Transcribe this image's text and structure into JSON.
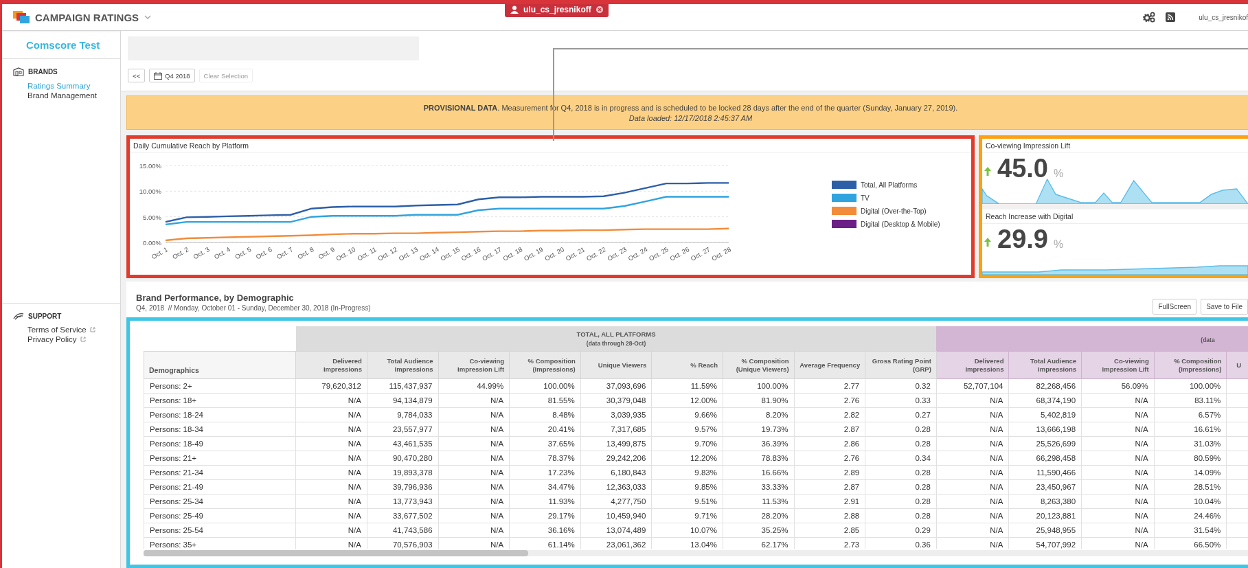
{
  "page_frame": {
    "color": "#d9343a"
  },
  "header": {
    "app_title": "CAMPAIGN RATINGS",
    "user_chip": "ulu_cs_jresnikoff",
    "user_name": "ulu_cs_jresnikof"
  },
  "sidebar": {
    "org": "Comscore Test",
    "sections": [
      {
        "title": "BRANDS",
        "kind": "brands",
        "items": [
          {
            "label": "Ratings Summary",
            "selected": true,
            "external": false
          },
          {
            "label": "Brand Management",
            "selected": false,
            "external": false
          }
        ]
      },
      {
        "title": "SUPPORT",
        "kind": "support",
        "items": [
          {
            "label": "Terms of Service",
            "selected": false,
            "external": true
          },
          {
            "label": "Privacy Policy",
            "selected": false,
            "external": true
          }
        ]
      }
    ]
  },
  "toolbar": {
    "back": "<<",
    "period": "Q4 2018",
    "clear": {
      "label": "Clear Selection",
      "disabled": true
    }
  },
  "banner": {
    "message": "**PROVISIONAL DATA**. Measurement for Q4, 2018 is in progress and is scheduled to be locked 28 days after the end of the quarter (Sunday, January 27, 2019).",
    "loaded": "Data loaded: 12/17/2018 2:45:37 AM"
  },
  "reach_chart": {
    "color": "#e23b2e",
    "chart_data": {
      "type": "line",
      "title": "Daily Cumulative Reach by Platform",
      "legend": true,
      "categories": [
        "Oct. 1",
        "Oct. 2",
        "Oct. 3",
        "Oct. 4",
        "Oct. 5",
        "Oct. 6",
        "Oct. 7",
        "Oct. 8",
        "Oct. 9",
        "Oct. 10",
        "Oct. 11",
        "Oct. 12",
        "Oct. 13",
        "Oct. 14",
        "Oct. 15",
        "Oct. 16",
        "Oct. 17",
        "Oct. 18",
        "Oct. 19",
        "Oct. 20",
        "Oct. 21",
        "Oct. 22",
        "Oct. 23",
        "Oct. 24",
        "Oct. 25",
        "Oct. 26",
        "Oct. 27",
        "Oct. 28"
      ],
      "ylim": [
        0,
        15
      ],
      "yticks": [
        {
          "value": 0,
          "label": "0.00%"
        },
        {
          "value": 5,
          "label": "5.00%"
        },
        {
          "value": 10,
          "label": "10.00%"
        },
        {
          "value": 15,
          "label": "15.00%"
        }
      ],
      "series": [
        {
          "name": "Total, All Platforms",
          "color": "#2c5fa8",
          "values": [
            4.0,
            4.9,
            5.0,
            5.1,
            5.2,
            5.3,
            5.4,
            6.6,
            6.9,
            7.0,
            7.0,
            7.0,
            7.2,
            7.3,
            7.4,
            8.4,
            8.8,
            8.8,
            8.9,
            8.9,
            8.9,
            9.0,
            9.7,
            10.6,
            11.5,
            11.5,
            11.6,
            11.6
          ]
        },
        {
          "name": "TV",
          "color": "#2fa4df",
          "values": [
            3.5,
            4.0,
            4.0,
            4.0,
            4.0,
            4.0,
            4.0,
            5.0,
            5.2,
            5.2,
            5.2,
            5.2,
            5.4,
            5.4,
            5.4,
            6.3,
            6.6,
            6.6,
            6.6,
            6.6,
            6.6,
            6.6,
            7.1,
            8.0,
            8.9,
            8.9,
            8.9,
            8.9
          ]
        },
        {
          "name": "Digital (Over-the-Top)",
          "color": "#f28c3a",
          "values": [
            0.4,
            0.8,
            0.9,
            1.0,
            1.1,
            1.2,
            1.3,
            1.4,
            1.6,
            1.7,
            1.7,
            1.8,
            1.8,
            1.9,
            2.0,
            2.1,
            2.2,
            2.2,
            2.3,
            2.3,
            2.4,
            2.4,
            2.5,
            2.6,
            2.6,
            2.6,
            2.6,
            2.7
          ]
        },
        {
          "name": "Digital (Desktop & Mobile)",
          "color": "#6b1f86",
          "values": [
            null,
            null,
            null,
            null,
            null,
            null,
            null,
            null,
            null,
            null,
            null,
            null,
            null,
            null,
            null,
            null,
            null,
            null,
            null,
            null,
            null,
            null,
            null,
            null,
            null,
            null,
            null,
            null
          ]
        }
      ]
    }
  },
  "kpis": {
    "color": "#ffa00f",
    "cards": [
      {
        "title": "Co-viewing Impression Lift",
        "value": "45.0",
        "unit": "%",
        "increase": true
      },
      {
        "title": "Reach Increase with Digital",
        "value": "29.9",
        "unit": "%",
        "increase": true
      }
    ]
  },
  "performance": {
    "title": "Brand Performance, by Demographic",
    "subtitle": "Q4, 2018  // Monday, October 01 - Sunday, December 30, 2018 (In-Progress)",
    "buttons": [
      "FullScreen",
      "Save to File"
    ]
  },
  "table": {
    "color": "#3fc6e5",
    "groups": [
      {
        "title": "TOTAL, ALL PLATFORMS",
        "note": "(data through 28-Oct)",
        "kind": "total"
      },
      {
        "note": "(data",
        "kind": "digital"
      }
    ],
    "columns": [
      {
        "label": "Demographics",
        "kind": "demographic"
      },
      {
        "label": "Delivered Impressions",
        "kind": "total"
      },
      {
        "label": "Total Audience Impressions",
        "kind": "total"
      },
      {
        "label": "Co-viewing Impression Lift",
        "kind": "total"
      },
      {
        "label": "% Composition (Impressions)",
        "kind": "total"
      },
      {
        "label": "Unique Viewers",
        "kind": "total"
      },
      {
        "label": "% Reach",
        "kind": "total"
      },
      {
        "label": "% Composition (Unique Viewers)",
        "kind": "total"
      },
      {
        "label": "Average Frequency",
        "kind": "total"
      },
      {
        "label": "Gross Rating Point (GRP)",
        "kind": "total"
      },
      {
        "label": "Delivered Impressions",
        "kind": "digital"
      },
      {
        "label": "Total Audience Impressions",
        "kind": "digital"
      },
      {
        "label": "Co-viewing Impression Lift",
        "kind": "digital"
      },
      {
        "label": "% Composition (Impressions)",
        "kind": "digital"
      },
      {
        "label": "U",
        "kind": "digital"
      }
    ],
    "rows": [
      [
        "Persons: 2+",
        "79,620,312",
        "115,437,937",
        "44.99%",
        "100.00%",
        "37,093,696",
        "11.59%",
        "100.00%",
        "2.77",
        "0.32",
        "52,707,104",
        "82,268,456",
        "56.09%",
        "100.00%"
      ],
      [
        "Persons: 18+",
        "N/A",
        "94,134,879",
        "N/A",
        "81.55%",
        "30,379,048",
        "12.00%",
        "81.90%",
        "2.76",
        "0.33",
        "N/A",
        "68,374,190",
        "N/A",
        "83.11%"
      ],
      [
        "Persons: 18-24",
        "N/A",
        "9,784,033",
        "N/A",
        "8.48%",
        "3,039,935",
        "9.66%",
        "8.20%",
        "2.82",
        "0.27",
        "N/A",
        "5,402,819",
        "N/A",
        "6.57%"
      ],
      [
        "Persons: 18-34",
        "N/A",
        "23,557,977",
        "N/A",
        "20.41%",
        "7,317,685",
        "9.57%",
        "19.73%",
        "2.87",
        "0.28",
        "N/A",
        "13,666,198",
        "N/A",
        "16.61%"
      ],
      [
        "Persons: 18-49",
        "N/A",
        "43,461,535",
        "N/A",
        "37.65%",
        "13,499,875",
        "9.70%",
        "36.39%",
        "2.86",
        "0.28",
        "N/A",
        "25,526,699",
        "N/A",
        "31.03%"
      ],
      [
        "Persons: 21+",
        "N/A",
        "90,470,280",
        "N/A",
        "78.37%",
        "29,242,206",
        "12.20%",
        "78.83%",
        "2.76",
        "0.34",
        "N/A",
        "66,298,458",
        "N/A",
        "80.59%"
      ],
      [
        "Persons: 21-34",
        "N/A",
        "19,893,378",
        "N/A",
        "17.23%",
        "6,180,843",
        "9.83%",
        "16.66%",
        "2.89",
        "0.28",
        "N/A",
        "11,590,466",
        "N/A",
        "14.09%"
      ],
      [
        "Persons: 21-49",
        "N/A",
        "39,796,936",
        "N/A",
        "34.47%",
        "12,363,033",
        "9.85%",
        "33.33%",
        "2.87",
        "0.28",
        "N/A",
        "23,450,967",
        "N/A",
        "28.51%"
      ],
      [
        "Persons: 25-34",
        "N/A",
        "13,773,943",
        "N/A",
        "11.93%",
        "4,277,750",
        "9.51%",
        "11.53%",
        "2.91",
        "0.28",
        "N/A",
        "8,263,380",
        "N/A",
        "10.04%"
      ],
      [
        "Persons: 25-49",
        "N/A",
        "33,677,502",
        "N/A",
        "29.17%",
        "10,459,940",
        "9.71%",
        "28.20%",
        "2.88",
        "0.28",
        "N/A",
        "20,123,881",
        "N/A",
        "24.46%"
      ],
      [
        "Persons: 25-54",
        "N/A",
        "41,743,586",
        "N/A",
        "36.16%",
        "13,074,489",
        "10.07%",
        "35.25%",
        "2.85",
        "0.29",
        "N/A",
        "25,948,955",
        "N/A",
        "31.54%"
      ],
      [
        "Persons: 35+",
        "N/A",
        "70,576,903",
        "N/A",
        "61.14%",
        "23,061,362",
        "13.04%",
        "62.17%",
        "2.73",
        "0.36",
        "N/A",
        "54,707,992",
        "N/A",
        "66.50%"
      ]
    ]
  }
}
